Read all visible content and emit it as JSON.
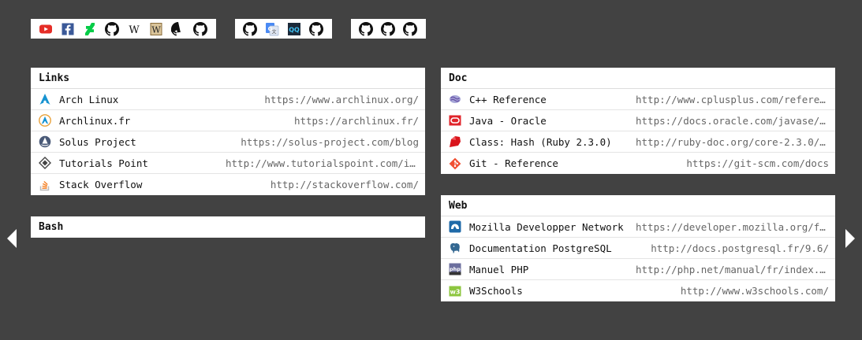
{
  "panels": {
    "links": {
      "title": "Links",
      "rows": [
        {
          "name": "Arch Linux",
          "url": "https://www.archlinux.org/",
          "icon": "arch-linux-icon"
        },
        {
          "name": "Archlinux.fr",
          "url": "https://archlinux.fr/",
          "icon": "archlinux-fr-icon"
        },
        {
          "name": "Solus Project",
          "url": "https://solus-project.com/blog",
          "icon": "solus-icon"
        },
        {
          "name": "Tutorials Point",
          "url": "http://www.tutorialspoint.com/ind…",
          "icon": "tutorialspoint-icon"
        },
        {
          "name": "Stack Overflow",
          "url": "http://stackoverflow.com/",
          "icon": "stackoverflow-icon"
        }
      ]
    },
    "bash": {
      "title": "Bash"
    },
    "doc": {
      "title": "Doc",
      "rows": [
        {
          "name": "C++ Reference",
          "url": "http://www.cplusplus.com/referenc…",
          "icon": "cplusplus-icon"
        },
        {
          "name": "Java - Oracle",
          "url": "https://docs.oracle.com/javase/8/…",
          "icon": "oracle-icon"
        },
        {
          "name": "Class: Hash (Ruby 2.3.0)",
          "url": "http://ruby-doc.org/core-2.3.0/Ha…",
          "icon": "ruby-icon"
        },
        {
          "name": "Git - Reference",
          "url": "https://git-scm.com/docs",
          "icon": "git-icon"
        }
      ]
    },
    "web": {
      "title": "Web",
      "rows": [
        {
          "name": "Mozilla Developper Network",
          "url": "https://developer.mozilla.org/fr/",
          "icon": "mdn-icon"
        },
        {
          "name": "Documentation PostgreSQL",
          "url": "http://docs.postgresql.fr/9.6/",
          "icon": "postgresql-icon"
        },
        {
          "name": "Manuel PHP",
          "url": "http://php.net/manual/fr/index.php",
          "icon": "php-icon"
        },
        {
          "name": "W3Schools",
          "url": "http://www.w3schools.com/",
          "icon": "w3schools-icon"
        }
      ]
    }
  },
  "iconbars": [
    [
      "youtube-icon",
      "facebook-icon",
      "deviantart-icon",
      "github-icon",
      "wikipedia-icon",
      "wiktionary-icon",
      "github-icon",
      "github-icon"
    ],
    [
      "github-icon",
      "google-translate-icon",
      "qq-icon",
      "github-icon"
    ],
    [
      "github-icon",
      "github-icon",
      "github-icon"
    ]
  ],
  "colors": {
    "background": "#424242",
    "panel": "#ffffff",
    "youtube": "#e52d27",
    "facebook": "#3b5998",
    "deviantart": "#05cc47"
  }
}
